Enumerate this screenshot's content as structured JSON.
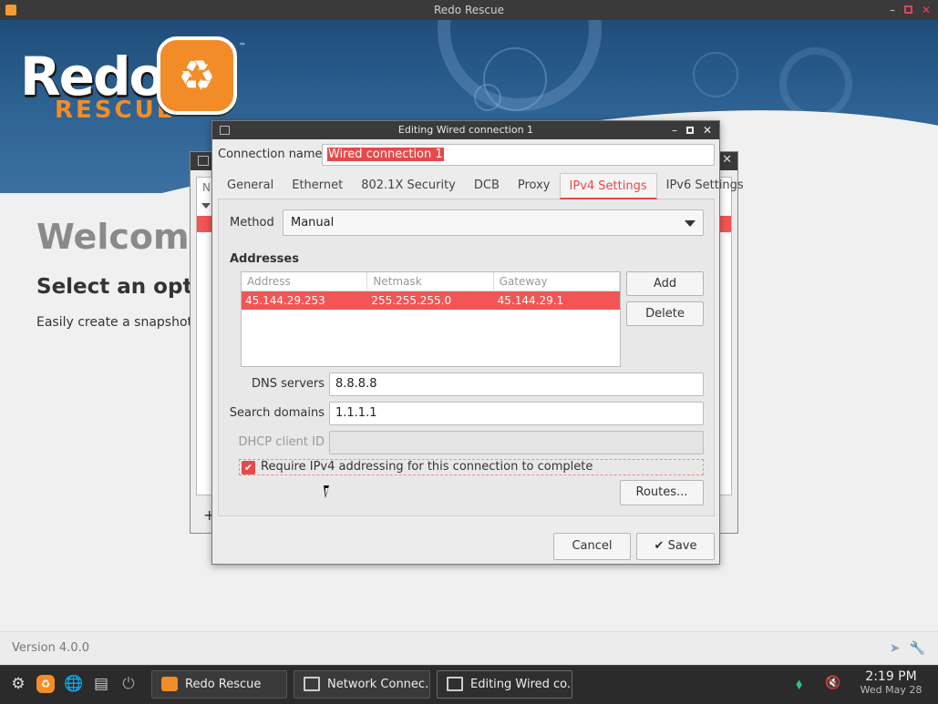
{
  "app": {
    "title": "Redo Rescue",
    "logo_word": "Redo",
    "logo_sub": "RESCUE",
    "logo_tm": "™"
  },
  "welcome": {
    "heading": "Welcome",
    "subheading": "Select an optio",
    "description": "Easily create a snapshot o"
  },
  "version_label": "Version 4.0.0",
  "background_window": {
    "header_fragment": "N",
    "add_symbol": "+"
  },
  "dialog": {
    "title": "Editing Wired connection 1",
    "connection_name_label": "Connection name",
    "connection_name_value": "Wired connection 1",
    "tabs": [
      {
        "label": "General",
        "active": false
      },
      {
        "label": "Ethernet",
        "active": false
      },
      {
        "label": "802.1X Security",
        "active": false
      },
      {
        "label": "DCB",
        "active": false
      },
      {
        "label": "Proxy",
        "active": false
      },
      {
        "label": "IPv4 Settings",
        "active": true
      },
      {
        "label": "IPv6 Settings",
        "active": false
      }
    ],
    "method_label": "Method",
    "method_value": "Manual",
    "addresses_label": "Addresses",
    "address_columns": [
      "Address",
      "Netmask",
      "Gateway"
    ],
    "address_rows": [
      {
        "address": "45.144.29.253",
        "netmask": "255.255.255.0",
        "gateway": "45.144.29.1",
        "selected": true
      }
    ],
    "add_label": "Add",
    "delete_label": "Delete",
    "dns_label": "DNS servers",
    "dns_value": "8.8.8.8",
    "search_label": "Search domains",
    "search_value": "1.1.1.1",
    "dhcp_label": "DHCP client ID",
    "dhcp_value": "",
    "require_ipv4_label": "Require IPv4 addressing for this connection to complete",
    "require_ipv4_checked": true,
    "routes_label": "Routes...",
    "cancel_label": "Cancel",
    "save_label": "Save"
  },
  "taskbar": {
    "tasks": [
      {
        "label": "Redo Rescue",
        "icon": "redo-icon",
        "active": false
      },
      {
        "label": "Network Connec...",
        "icon": "network-icon",
        "active": false
      },
      {
        "label": "Editing Wired co...",
        "icon": "network-icon",
        "active": true
      }
    ],
    "clock_time": "2:19 PM",
    "clock_date": "Wed May 28"
  },
  "colors": {
    "accent": "#e8484a",
    "selection": "#f25555",
    "brand_orange": "#f28c28",
    "titlebar": "#3a3a3a",
    "banner_blue": "#2f6494"
  }
}
